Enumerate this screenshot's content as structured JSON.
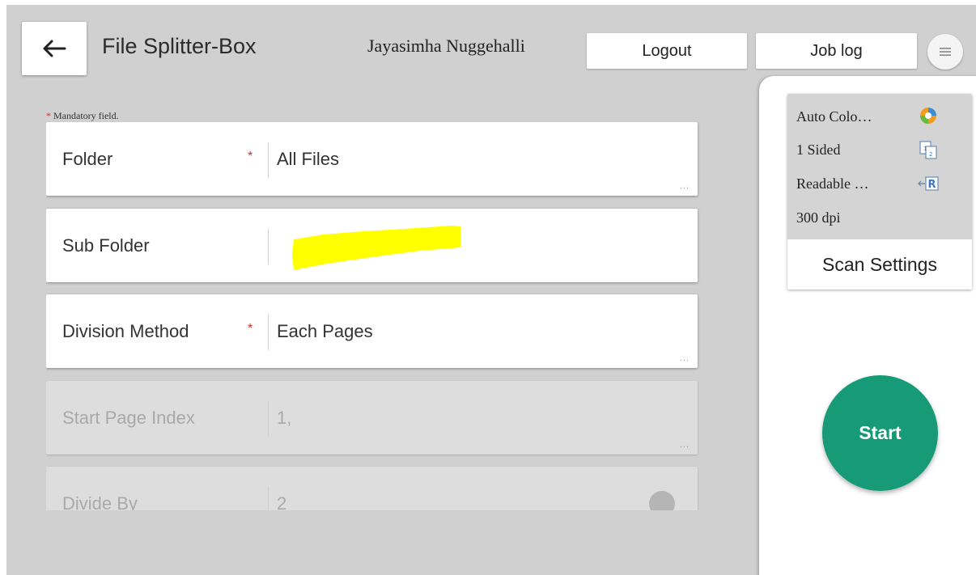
{
  "header": {
    "back_icon": "arrow-left-icon",
    "title": "File Splitter-Box",
    "user_name": "Jayasimha Nuggehalli",
    "logout_label": "Logout",
    "job_log_label": "Job log",
    "menu_icon": "hamburger-menu-icon"
  },
  "form": {
    "mandatory_note": "Mandatory field.",
    "fields": [
      {
        "label": "Folder",
        "required": true,
        "value": "All Files",
        "more": "...",
        "enabled": true
      },
      {
        "label": "Sub Folder",
        "required": false,
        "value": "",
        "value_redacted": true,
        "enabled": true
      },
      {
        "label": "Division Method",
        "required": true,
        "value": "Each Pages",
        "more": "...",
        "enabled": true
      },
      {
        "label": "Start Page Index",
        "required": false,
        "value": "1,",
        "more": "...",
        "enabled": false
      },
      {
        "label": "Divide By",
        "required": false,
        "value": "2",
        "enabled": false
      }
    ]
  },
  "scan_settings": {
    "items": [
      {
        "text": "Auto Colo…",
        "icon": "auto-color-icon"
      },
      {
        "text": "1 Sided",
        "icon": "one-sided-page-icon"
      },
      {
        "text": "Readable …",
        "icon": "readable-direction-icon"
      },
      {
        "text": "300 dpi",
        "icon": ""
      }
    ],
    "label": "Scan Settings"
  },
  "start_label": "Start",
  "colors": {
    "background": "#d0d0d0",
    "start_button": "#169a77",
    "required_star": "#d32f2f",
    "highlight": "#ffff00"
  }
}
